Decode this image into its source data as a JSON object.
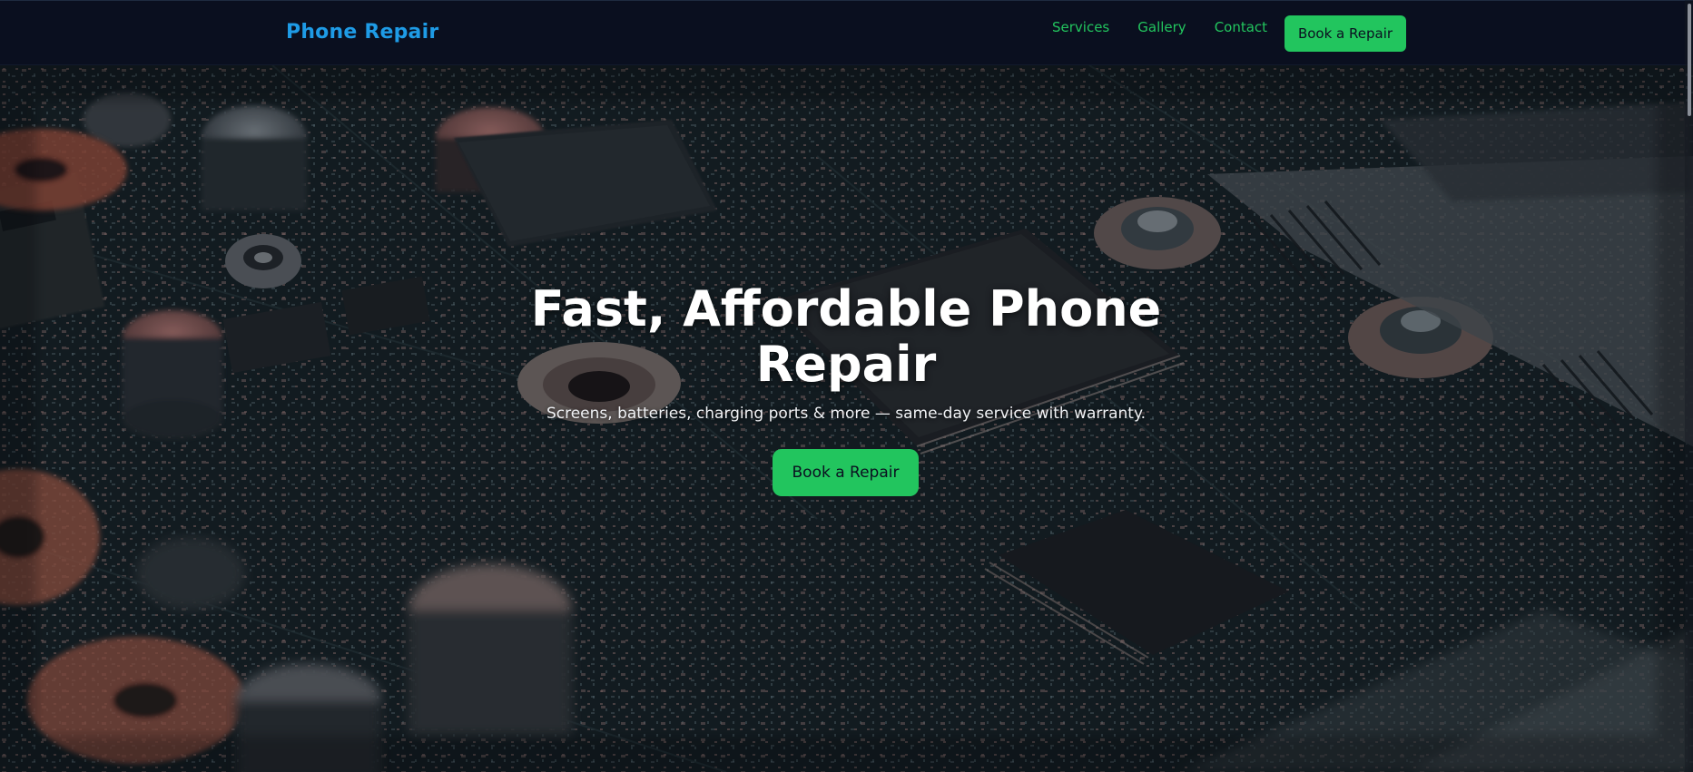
{
  "header": {
    "brand": "Phone Repair",
    "nav": [
      "Services",
      "Gallery",
      "Contact"
    ],
    "cta_label": "Book a Repair"
  },
  "hero": {
    "title": "Fast, Affordable Phone Repair",
    "subtitle": "Screens, batteries, charging ports & more — same-day service with warranty.",
    "cta_label": "Book a Repair",
    "background_image": "circuit-board-photo"
  },
  "colors": {
    "brand": "#1e9be6",
    "accent": "#22c55e",
    "header_bg": "#0a0f1f"
  }
}
